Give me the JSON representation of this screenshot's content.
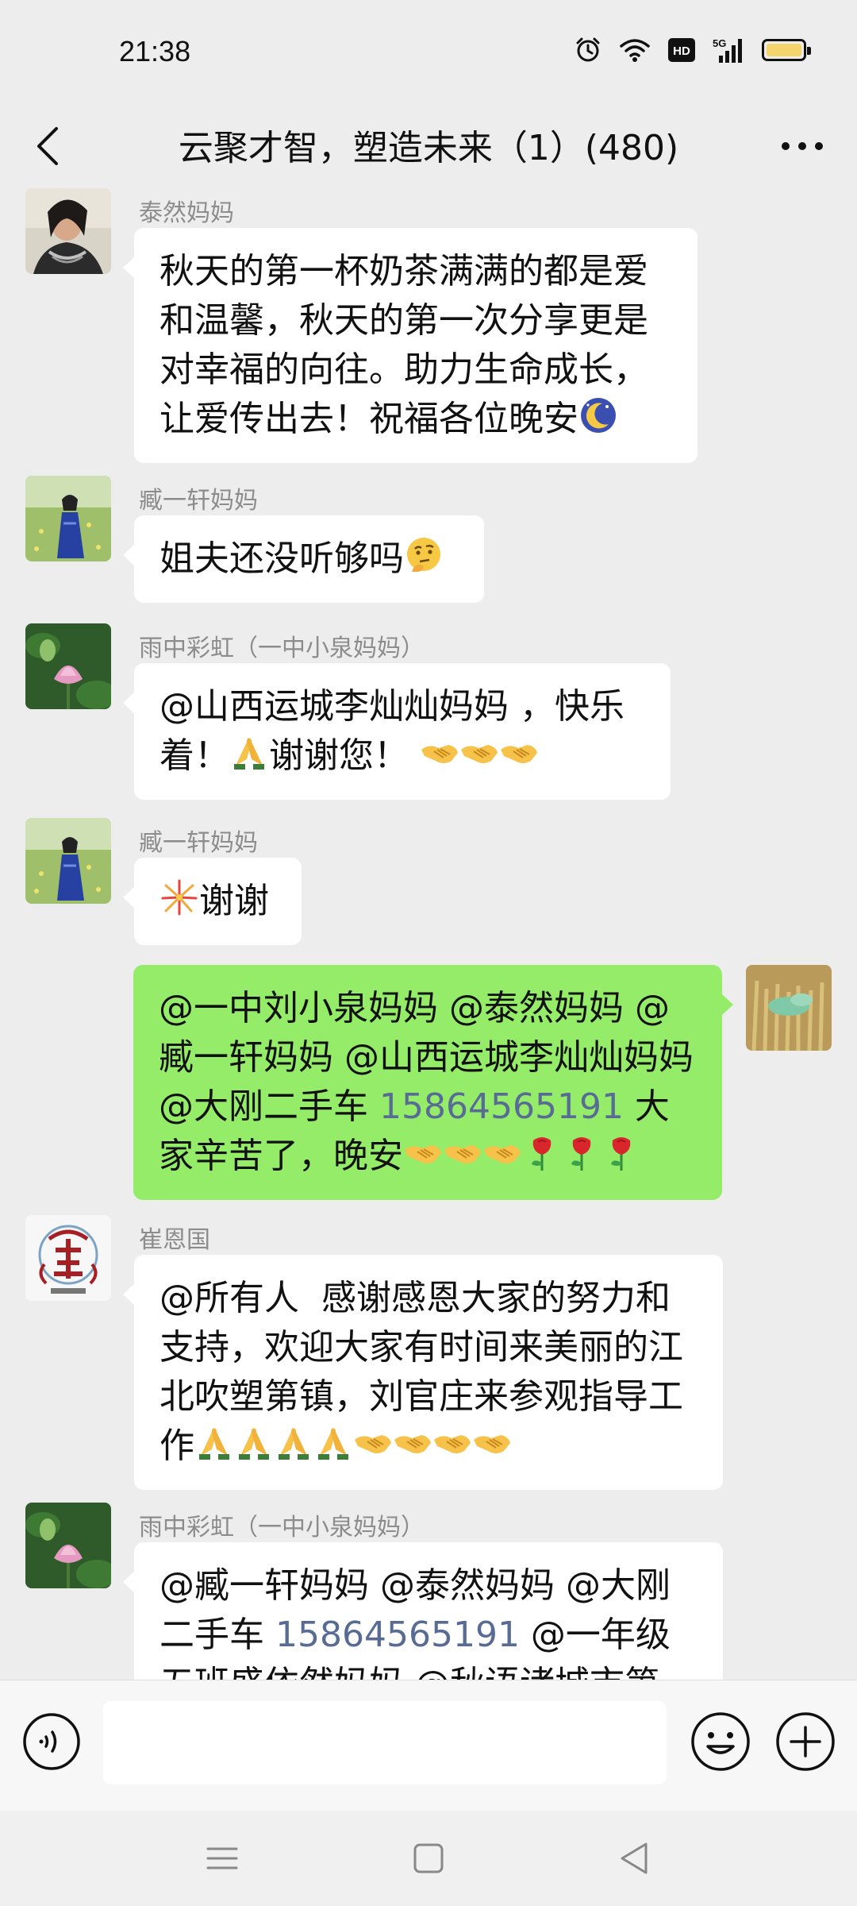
{
  "status_bar": {
    "time": "21:38",
    "icons": [
      "alarm-icon",
      "wifi-icon",
      "hd-icon",
      "5g-signal-icon",
      "battery-icon"
    ],
    "hd_label": "HD",
    "network_label": "5G",
    "battery_color": "#f4d56c"
  },
  "header": {
    "title": "云聚才智，塑造未来（1）(480)"
  },
  "messages": [
    {
      "sender": "泰然妈妈",
      "text": "秋天的第一杯奶茶满满的都是爱和温馨，秋天的第一次分享更是对幸福的向往。助力生命成长，让爱传出去！祝福各位晚安",
      "emoji": "moon-sleep-emoji"
    },
    {
      "sender": "臧一轩妈妈",
      "text": "姐夫还没听够吗",
      "emoji": "thinking-face-emoji"
    },
    {
      "sender": "雨中彩虹（一中小泉妈妈）",
      "line1": "@山西运城李灿灿妈妈 ，快乐",
      "line2": "着！",
      "line2b": "谢谢您！",
      "emojis": [
        "folded-hands-emoji",
        "handshake-emoji"
      ]
    },
    {
      "sender": "臧一轩妈妈",
      "text": "谢谢",
      "emoji": "fireworks-emoji"
    },
    {
      "outgoing": true,
      "text_before_phone": "@一中刘小泉妈妈 @泰然妈妈 @臧一轩妈妈 @山西运城李灿灿妈妈 @大刚二手车 ",
      "phone": "15864565191",
      "text_after_phone": " 大家辛苦了，晚安",
      "emojis": [
        "handshake-emoji",
        "rose-emoji"
      ]
    },
    {
      "sender": "崔恩国",
      "text": "@所有人  感谢感恩大家的努力和支持，欢迎大家有时间来美丽的江北吹塑第镇，刘官庄来参观指导工作",
      "emojis": [
        "folded-hands-emoji",
        "handshake-emoji"
      ]
    },
    {
      "sender": "雨中彩虹（一中小泉妈妈）",
      "text_before_phone": "@臧一轩妈妈 @泰然妈妈 @大刚二手车 ",
      "phone": "15864565191",
      "text_after_phone": " @一年级五班盛依然妈妈 @秋语诸城市第一"
    }
  ],
  "input_bar": {
    "placeholder": "",
    "value": ""
  },
  "colors": {
    "background": "#ededed",
    "incoming_bubble": "#ffffff",
    "outgoing_bubble": "#95ec69",
    "phone_link": "#576b95",
    "sender_name": "#8c8c8c"
  }
}
